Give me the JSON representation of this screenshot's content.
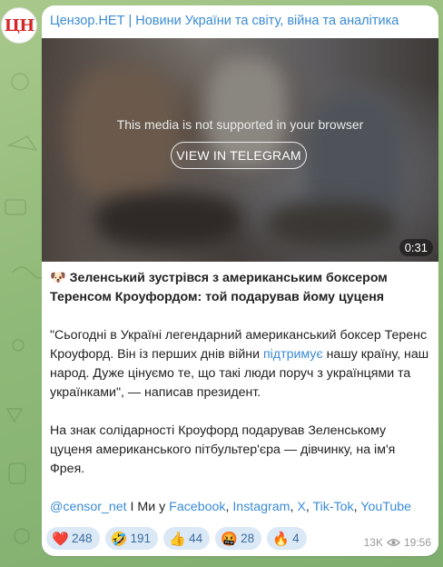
{
  "channel": {
    "name": "Цензор.НЕТ | Новини України та світу, війна та аналітика",
    "avatar_text": "ЦН"
  },
  "media": {
    "unsupported_text": "This media is not supported in your browser",
    "button_label": "VIEW IN TELEGRAM",
    "duration": "0:31"
  },
  "post": {
    "title_emoji": "🐶",
    "title": "Зеленський зустрівся з американським боксером Теренсом Кроуфордом: той подарував йому цуценя",
    "para1_before": "\"Сьогодні в Україні легендарний американський боксер Теренс Кроуфорд. Він із перших днів війни ",
    "para1_link": "підтримує",
    "para1_after": " нашу країну, наш народ. Дуже цінуємо те, що такі люди поруч з українцями та українками\", — написав президент.",
    "para2": "На знак солідарності Кроуфорд подарував Зеленському цуценя американського пітбультер'єра — дівчинку, на ім'я Фрея.",
    "footer": {
      "handle": "@censor_net",
      "mid": " I Ми у ",
      "facebook": "Facebook",
      "sep1": ", ",
      "instagram": "Instagram",
      "sep2": ", ",
      "x": "X",
      "sep3": ", ",
      "tiktok": "Tik-Tok",
      "sep4": ", ",
      "youtube": "YouTube"
    }
  },
  "reactions": [
    {
      "emoji": "❤️",
      "count": "248"
    },
    {
      "emoji": "🤣",
      "count": "191"
    },
    {
      "emoji": "👍",
      "count": "44"
    },
    {
      "emoji": "🤬",
      "count": "28"
    },
    {
      "emoji": "🔥",
      "count": "4"
    }
  ],
  "meta": {
    "views": "13K",
    "time": "19:56"
  },
  "colors": {
    "link": "#3a8bd5",
    "reaction_bg": "#dbe8f6",
    "background": "#8fb978"
  }
}
